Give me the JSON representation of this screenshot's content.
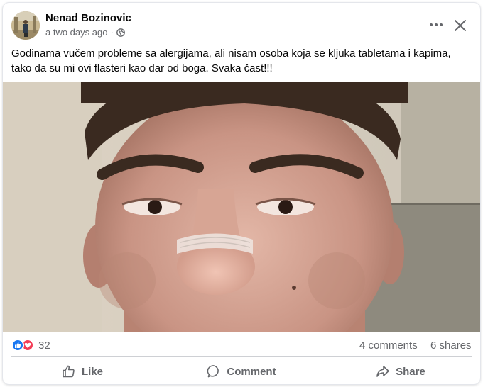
{
  "post": {
    "author": "Nenad Bozinovic",
    "time": "a two days ago",
    "separator": "·",
    "text": "Godinama vučem probleme sa alergijama, ali nisam osoba koja se kljuka tabletama i kapima, tako da su mi ovi flasteri kao dar od boga. Svaka čast!!!"
  },
  "stats": {
    "reaction_count": "32",
    "comments": "4 comments",
    "shares": "6 shares"
  },
  "actions": {
    "like": "Like",
    "comment": "Comment",
    "share": "Share"
  },
  "colors": {
    "like_blue": "#1877f2",
    "love_red": "#f33e58",
    "secondary_text": "#65676b"
  }
}
